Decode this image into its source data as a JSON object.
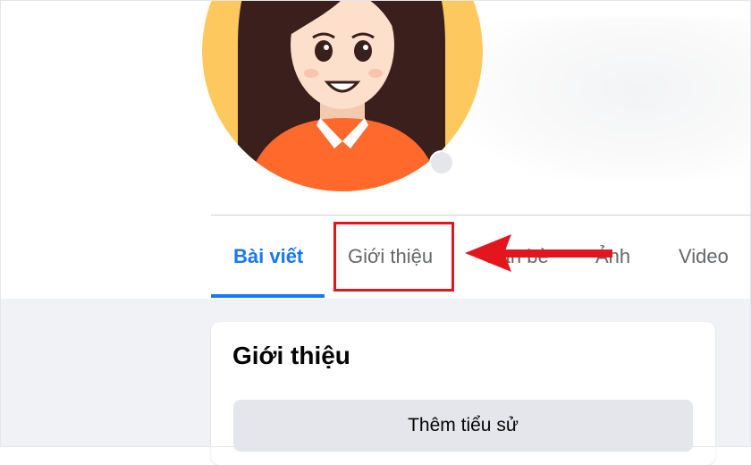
{
  "profile": {
    "avatar_icon": "cartoon-girl-avatar",
    "colors": {
      "avatar_bg": "#fdc95e",
      "hair": "#3b1f1c",
      "skin": "#fde0cc",
      "shirt": "#ff6a2c"
    }
  },
  "tabs": [
    {
      "label": "Bài viết",
      "active": true
    },
    {
      "label": "Giới thiệu",
      "active": false
    },
    {
      "label": "Bạn bè",
      "active": false
    },
    {
      "label": "Ảnh",
      "active": false
    },
    {
      "label": "Video",
      "active": false
    }
  ],
  "annotation": {
    "highlight_color": "#e3161e",
    "target_tab": "Giới thiệu"
  },
  "intro_card": {
    "title": "Giới thiệu",
    "add_bio_label": "Thêm tiểu sử"
  },
  "theme": {
    "accent": "#1877f2",
    "tab_text": "#65676b",
    "page_bg": "#f0f2f5"
  }
}
